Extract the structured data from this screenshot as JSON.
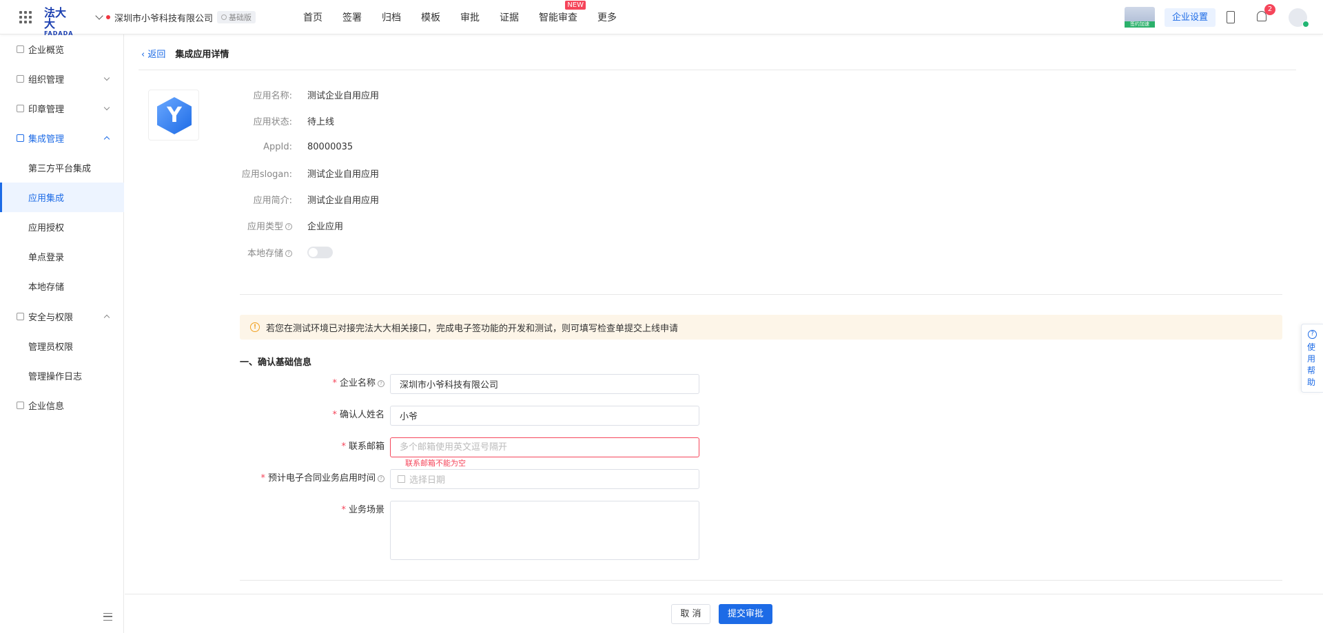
{
  "header": {
    "logo_cn": "法大大",
    "logo_en": "FADADA",
    "company_name": "深圳市小爷科技有限公司",
    "edition": "基础版",
    "nav": [
      {
        "label": "首页"
      },
      {
        "label": "签署"
      },
      {
        "label": "归档"
      },
      {
        "label": "模板"
      },
      {
        "label": "审批"
      },
      {
        "label": "证据"
      },
      {
        "label": "智能审查",
        "badge": "NEW"
      },
      {
        "label": "更多"
      }
    ],
    "promo_text": "签约加速",
    "enterprise_settings": "企业设置",
    "notification_count": "2"
  },
  "sidebar": {
    "items": [
      {
        "label": "企业概览",
        "icon": "overview-icon"
      },
      {
        "label": "组织管理",
        "icon": "org-icon"
      },
      {
        "label": "印章管理",
        "icon": "seal-icon"
      },
      {
        "label": "集成管理",
        "icon": "layers-icon"
      },
      {
        "label": "第三方平台集成"
      },
      {
        "label": "应用集成"
      },
      {
        "label": "应用授权"
      },
      {
        "label": "单点登录"
      },
      {
        "label": "本地存储"
      },
      {
        "label": "安全与权限",
        "icon": "security-icon"
      },
      {
        "label": "管理员权限"
      },
      {
        "label": "管理操作日志"
      },
      {
        "label": "企业信息",
        "icon": "info-icon"
      }
    ]
  },
  "page": {
    "back": "返回",
    "title": "集成应用详情"
  },
  "app_info": {
    "name_label": "应用名称:",
    "name_value": "测试企业自用应用",
    "status_label": "应用状态:",
    "status_value": "待上线",
    "appid_label": "AppId:",
    "appid_value": "80000035",
    "slogan_label": "应用slogan:",
    "slogan_value": "测试企业自用应用",
    "intro_label": "应用简介:",
    "intro_value": "测试企业自用应用",
    "type_label": "应用类型",
    "type_value": "企业应用",
    "storage_label": "本地存储",
    "storage_enabled": false
  },
  "notice": "若您在测试环境已对接完法大大相关接口，完成电子签功能的开发和测试，则可填写检查单提交上线申请",
  "form": {
    "section_title": "一、确认基础信息",
    "company_label": "企业名称",
    "company_value": "深圳市小爷科技有限公司",
    "confirmer_label": "确认人姓名",
    "confirmer_value": "小爷",
    "email_label": "联系邮箱",
    "email_placeholder": "多个邮箱使用英文逗号隔开",
    "email_error": "联系邮箱不能为空",
    "date_label": "预计电子合同业务启用时间",
    "date_placeholder": "选择日期",
    "scene_label": "业务场景",
    "scene_value": ""
  },
  "footer": {
    "cancel": "取 消",
    "submit": "提交审批"
  },
  "help": {
    "text": "使用帮助"
  },
  "colors": {
    "primary": "#1d6be6",
    "danger": "#f5455a",
    "warning_bg": "#fdf5e8"
  }
}
